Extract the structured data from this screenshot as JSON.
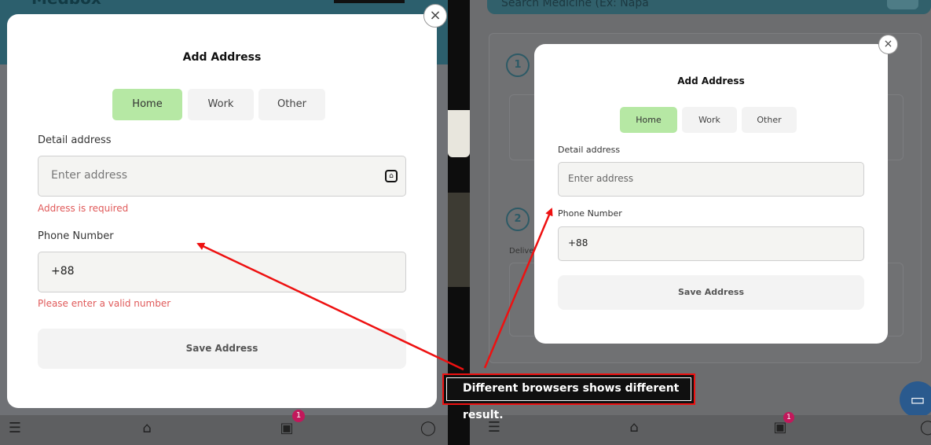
{
  "left": {
    "header": {
      "title": "Medbox"
    },
    "modal": {
      "close": "×",
      "title": "Add Address",
      "tabs": [
        {
          "label": "Home",
          "active": true
        },
        {
          "label": "Work",
          "active": false
        },
        {
          "label": "Other",
          "active": false
        }
      ],
      "detail_label": "Detail address",
      "address_placeholder": "Enter address",
      "address_error": "Address is required",
      "phone_label": "Phone Number",
      "phone_value": "+88",
      "phone_error": "Please enter a valid number",
      "save_label": "Save Address"
    },
    "bottom_nav": {
      "cart_badge": "1"
    }
  },
  "right": {
    "search_placeholder": "Search Medicine (Ex: Napa",
    "step1": "1",
    "step2": "2",
    "deliver_label": "Delive",
    "modal": {
      "close": "×",
      "title": "Add Address",
      "tabs": [
        {
          "label": "Home",
          "active": true
        },
        {
          "label": "Work",
          "active": false
        },
        {
          "label": "Other",
          "active": false
        }
      ],
      "detail_label": "Detail address",
      "address_placeholder": "Enter address",
      "phone_label": "Phone Number",
      "phone_value": "+88",
      "save_label": "Save Address"
    },
    "bottom_nav": {
      "cart_badge": "1"
    }
  },
  "annotation": {
    "text": "Different browsers shows different result."
  },
  "colors": {
    "active_tab": "#b6e8a4",
    "error": "#e05a5a",
    "annotation_border": "#ee1111",
    "arrow": "#ee1111"
  }
}
